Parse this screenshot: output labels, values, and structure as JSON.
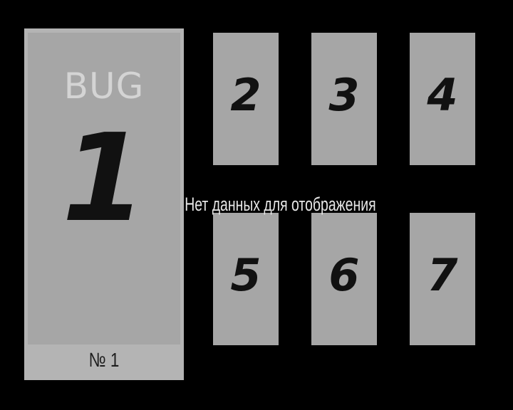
{
  "main_card": {
    "label": "BUG",
    "number": "1",
    "footer": "№ 1"
  },
  "slots": [
    {
      "number": "2"
    },
    {
      "number": "3"
    },
    {
      "number": "4"
    },
    {
      "number": "5"
    },
    {
      "number": "6"
    },
    {
      "number": "7"
    }
  ],
  "overlay": {
    "message": "Нет данных для отображения"
  },
  "colors": {
    "background": "#000000",
    "card": "#a6a6a6",
    "card_border": "#b4b4b4",
    "text": "#111111",
    "bug_label": "#d4d4d4",
    "message": "#e6e6e6"
  }
}
